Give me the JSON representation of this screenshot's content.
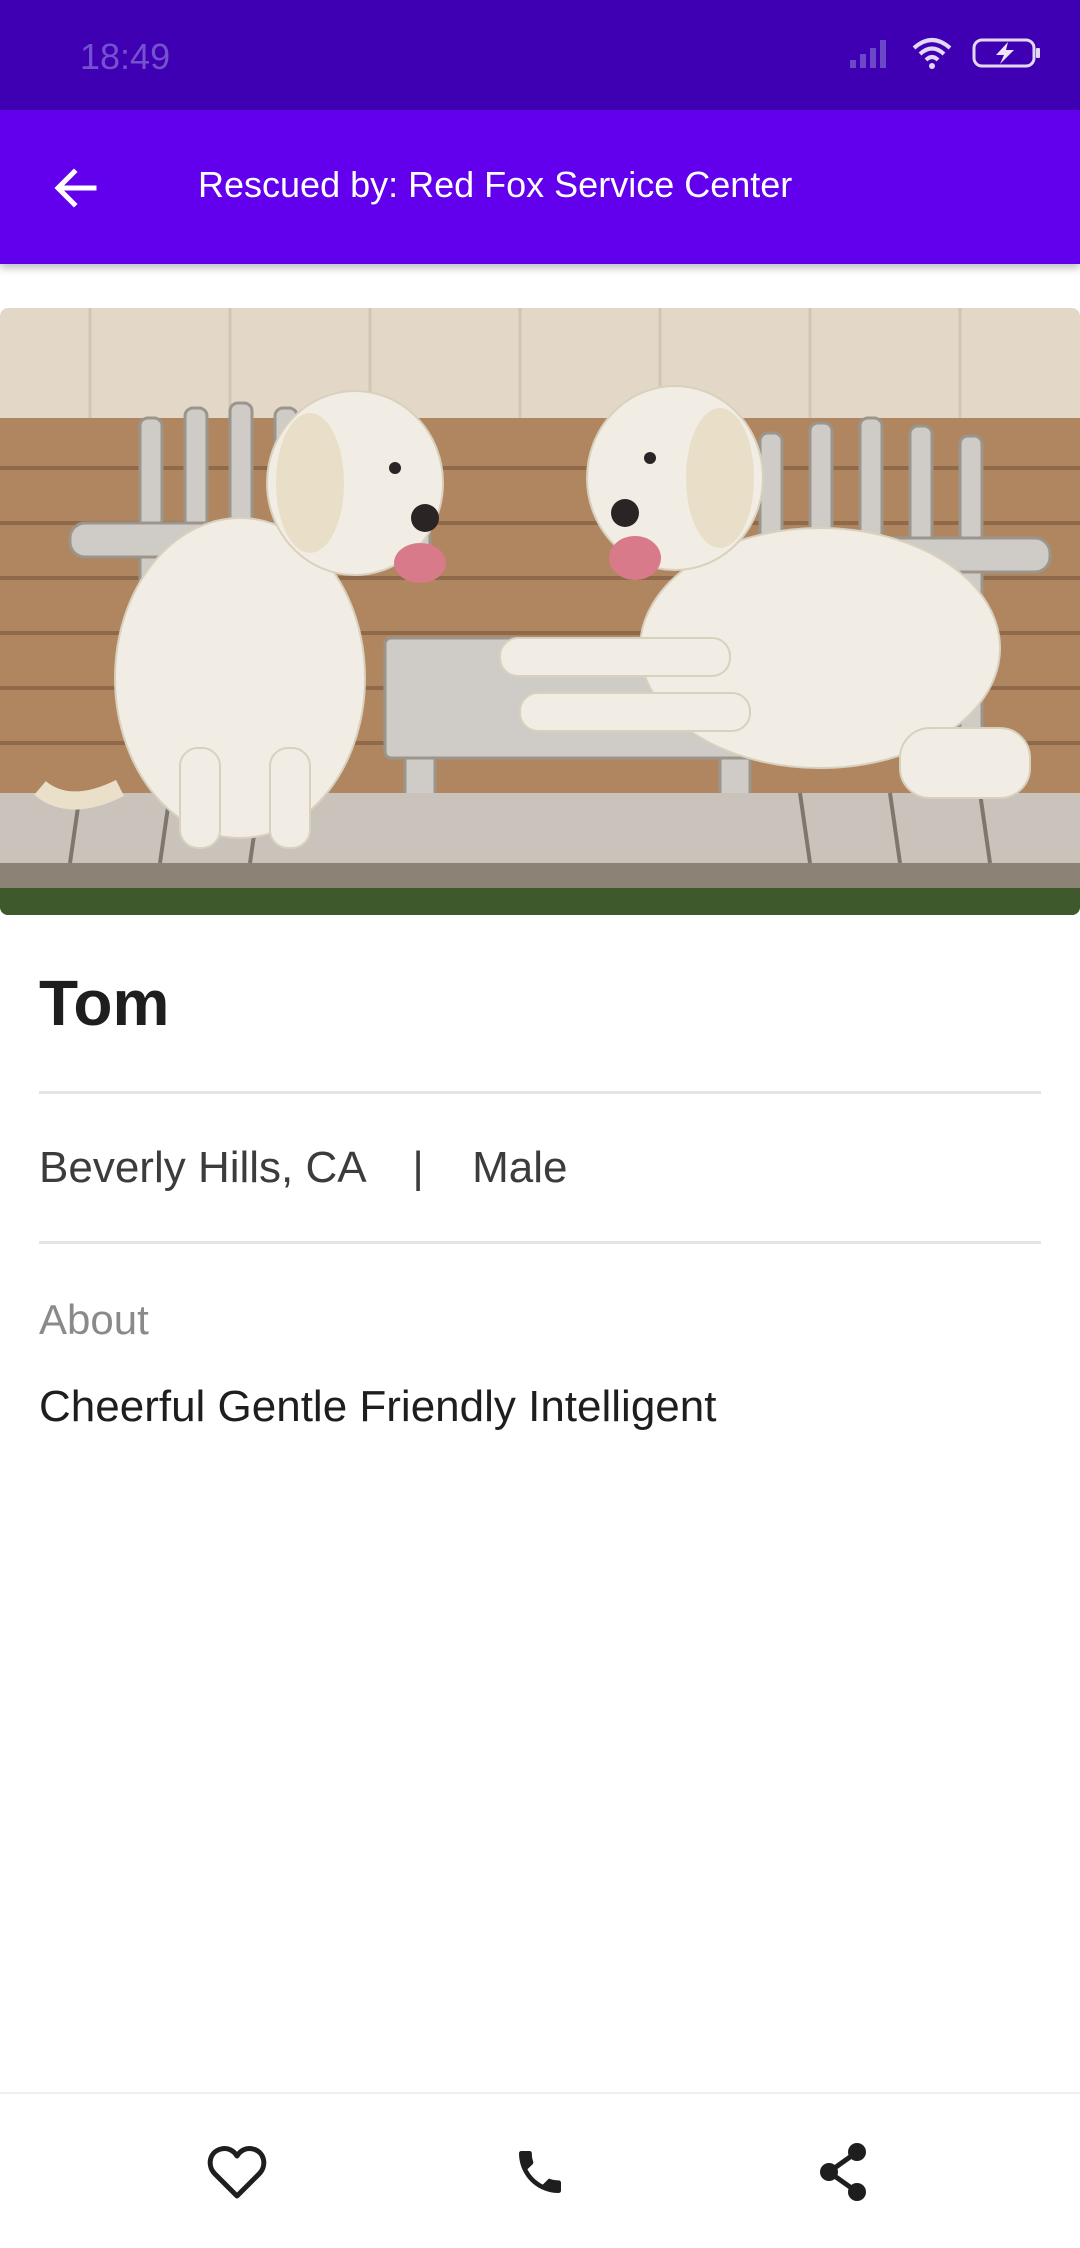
{
  "status_bar": {
    "time": "18:49",
    "icons": [
      "signal-icon",
      "wifi-icon",
      "battery-charging-icon"
    ]
  },
  "app_bar": {
    "title": "Rescued by: Red Fox Service Center",
    "back_icon": "arrow-left-icon"
  },
  "pet": {
    "photo_icon": "dog-photo",
    "name": "Tom",
    "location": "Beverly Hills, CA",
    "separator": "|",
    "gender": "Male",
    "about_label": "About",
    "about_text": "Cheerful Gentle Friendly Intelligent"
  },
  "bottom_bar": {
    "icons": [
      "heart-icon",
      "phone-icon",
      "share-icon"
    ]
  },
  "colors": {
    "status_bar": "#3f00b3",
    "app_bar": "#6200ee",
    "text_primary": "#1e1e1e",
    "text_secondary": "#8a8a8a"
  }
}
